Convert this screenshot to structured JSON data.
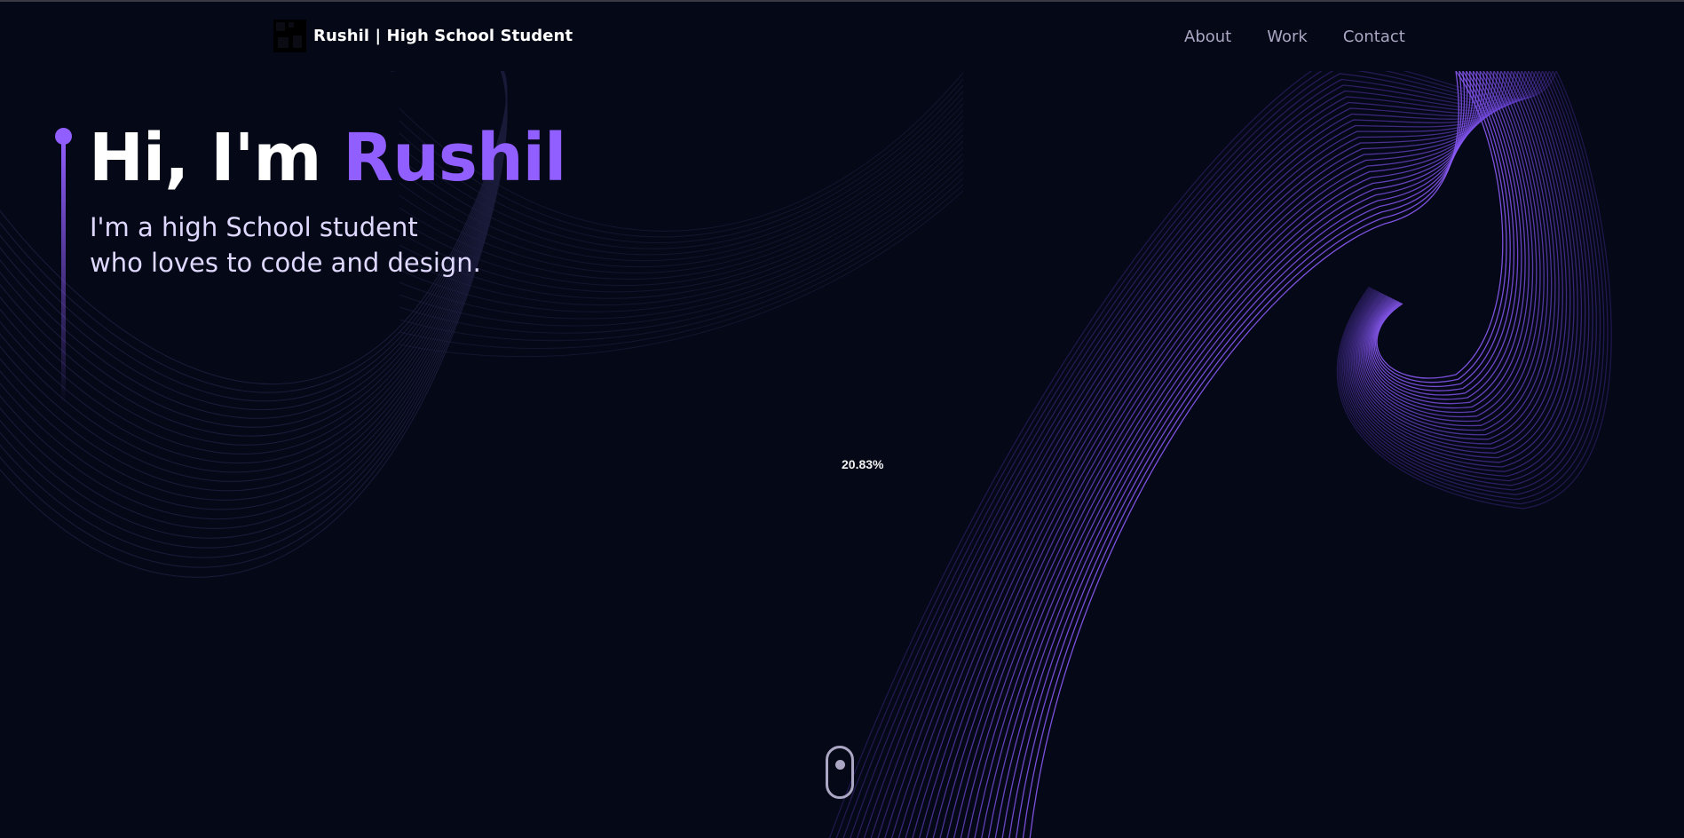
{
  "navbar": {
    "brand_name": "Rushil ",
    "brand_tagline": "| High School Student",
    "links": [
      {
        "label": "About"
      },
      {
        "label": "Work"
      },
      {
        "label": "Contact"
      }
    ]
  },
  "hero": {
    "title_prefix": "Hi, I'm ",
    "title_name": "Rushil",
    "subtitle_line1": "I'm a high School student",
    "subtitle_line2": "who loves to code and design."
  },
  "loader": {
    "progress_text": "20.83%"
  },
  "colors": {
    "background": "#050816",
    "accent": "#915eff",
    "nav_text": "#aaa6c3",
    "text": "#ffffff"
  },
  "icons": {
    "scroll": "mouse-scroll-icon",
    "logo": "logo-icon"
  }
}
